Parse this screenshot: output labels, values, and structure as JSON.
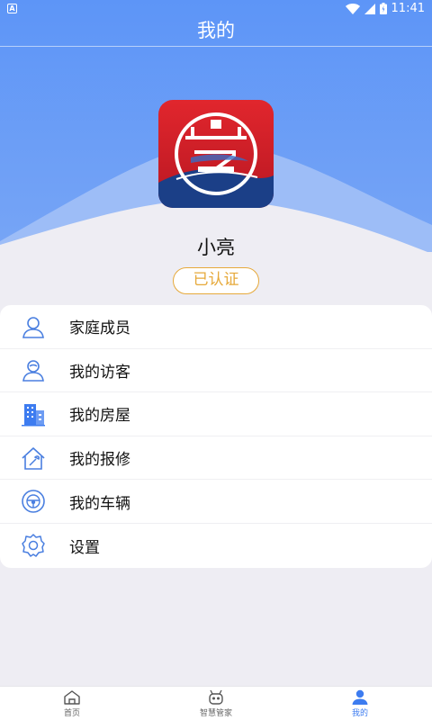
{
  "status_bar": {
    "left_icon": "A",
    "time": "11:41",
    "icons": [
      "wifi-icon",
      "cell-signal-icon",
      "battery-icon"
    ]
  },
  "header": {
    "title": "我的"
  },
  "profile": {
    "username": "小亮",
    "badge": "已认证",
    "badge_color": "#e6a93a"
  },
  "menu": {
    "items": [
      {
        "label": "家庭成员",
        "icon": "family-member-icon"
      },
      {
        "label": "我的访客",
        "icon": "visitor-icon"
      },
      {
        "label": "我的房屋",
        "icon": "building-icon"
      },
      {
        "label": "我的报修",
        "icon": "repair-house-icon"
      },
      {
        "label": "我的车辆",
        "icon": "steering-wheel-icon"
      },
      {
        "label": "设置",
        "icon": "settings-gear-icon"
      }
    ]
  },
  "tabbar": {
    "tabs": [
      {
        "label": "首页",
        "icon": "home-icon",
        "active": false
      },
      {
        "label": "智慧管家",
        "icon": "robot-icon",
        "active": false
      },
      {
        "label": "我的",
        "icon": "user-icon",
        "active": true
      }
    ]
  },
  "colors": {
    "accent": "#3d7cf0",
    "hero_top": "#4f8cf6",
    "hero_bottom": "#7eabf7",
    "background": "#eeedf3"
  }
}
